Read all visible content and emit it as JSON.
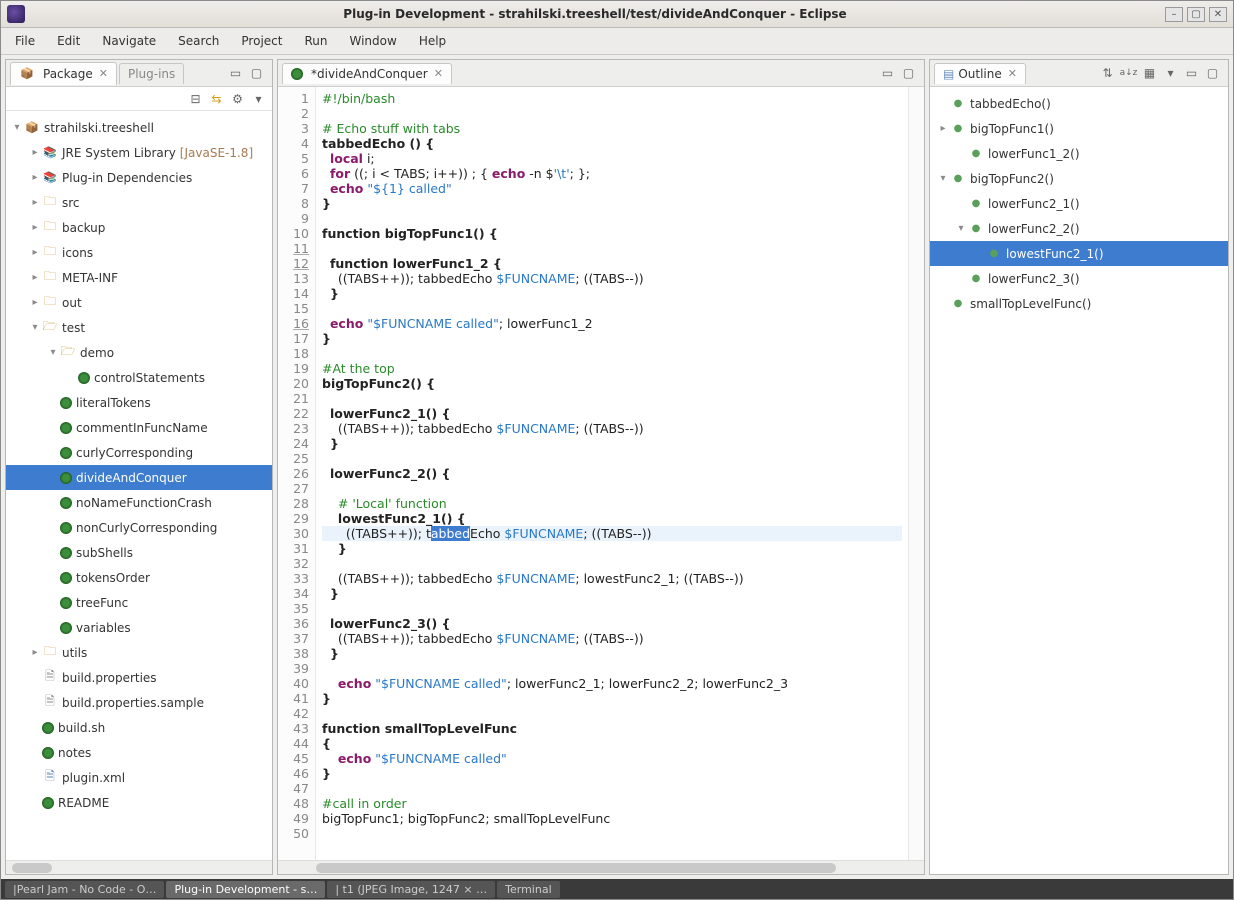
{
  "title": "Plug-in Development - strahilski.treeshell/test/divideAndConquer - Eclipse",
  "menus": [
    "File",
    "Edit",
    "Navigate",
    "Search",
    "Project",
    "Run",
    "Window",
    "Help"
  ],
  "leftView": {
    "tabs": [
      {
        "label": "Package",
        "active": true,
        "closex": "✕"
      },
      {
        "label": "Plug-ins",
        "active": false
      }
    ],
    "project": "strahilski.treeshell",
    "jre_label": "JRE System Library",
    "jre_extra": "[JavaSE-1.8]",
    "plugin_deps": "Plug-in Dependencies",
    "folders": {
      "src": "src",
      "backup": "backup",
      "icons": "icons",
      "metainf": "META-INF",
      "out": "out",
      "test": "test",
      "demo": "demo",
      "utils": "utils"
    },
    "demo_child": "controlStatements",
    "test_files": [
      "literalTokens",
      "commentInFuncName",
      "curlyCorresponding",
      "divideAndConquer",
      "noNameFunctionCrash",
      "nonCurlyCorresponding",
      "subShells",
      "tokensOrder",
      "treeFunc",
      "variables"
    ],
    "root_files": {
      "build_properties": "build.properties",
      "build_properties_sample": "build.properties.sample",
      "build_sh": "build.sh",
      "notes": "notes",
      "plugin_xml": "plugin.xml",
      "readme": "README"
    },
    "selected": "divideAndConquer"
  },
  "editor": {
    "tab_label": "*divideAndConquer",
    "lines": [
      {
        "n": 1,
        "html": "<span class='cm'>#!/bin/bash</span>"
      },
      {
        "n": 2,
        "html": ""
      },
      {
        "n": 3,
        "html": "<span class='cm'># Echo stuff with tabs</span>"
      },
      {
        "n": 4,
        "html": "<span class='funcdef'>tabbedEcho () {</span>"
      },
      {
        "n": 5,
        "html": "  <span class='kw'>local</span> i;"
      },
      {
        "n": 6,
        "html": "  <span class='kw'>for</span> ((; i &lt; TABS; i++)) ; { <span class='kw'>echo</span> -n $<span class='str'>'\\t'</span>; };"
      },
      {
        "n": 7,
        "html": "  <span class='kw'>echo</span> <span class='str'>\"<span class='var'>${1}</span> called\"</span>"
      },
      {
        "n": 8,
        "html": "<span class='funcdef'>}</span>"
      },
      {
        "n": 9,
        "html": ""
      },
      {
        "n": 10,
        "html": "<span class='funcdef'>function bigTopFunc1() {</span>"
      },
      {
        "n": 11,
        "html": "",
        "u": true
      },
      {
        "n": 12,
        "html": "  <span class='funcdef'>function lowerFunc1_2 {</span>",
        "u": true
      },
      {
        "n": 13,
        "html": "    ((TABS++)); tabbedEcho <span class='var'>$FUNCNAME</span>; ((TABS--))"
      },
      {
        "n": 14,
        "html": "  <span class='funcdef'>}</span>"
      },
      {
        "n": 15,
        "html": ""
      },
      {
        "n": 16,
        "html": "  <span class='kw'>echo</span> <span class='str'>\"<span class='var'>$FUNCNAME</span> called\"</span>; lowerFunc1_2",
        "u": true
      },
      {
        "n": 17,
        "html": "<span class='funcdef'>}</span>"
      },
      {
        "n": 18,
        "html": ""
      },
      {
        "n": 19,
        "html": "<span class='cm'>#At the top</span>"
      },
      {
        "n": 20,
        "html": "<span class='funcdef'>bigTopFunc2() {</span>"
      },
      {
        "n": 21,
        "html": ""
      },
      {
        "n": 22,
        "html": "  <span class='funcdef'>lowerFunc2_1() {</span>"
      },
      {
        "n": 23,
        "html": "    ((TABS++)); tabbedEcho <span class='var'>$FUNCNAME</span>; ((TABS--))"
      },
      {
        "n": 24,
        "html": "  <span class='funcdef'>}</span>"
      },
      {
        "n": 25,
        "html": ""
      },
      {
        "n": 26,
        "html": "  <span class='funcdef'>lowerFunc2_2() {</span>"
      },
      {
        "n": 27,
        "html": ""
      },
      {
        "n": 28,
        "html": "    <span class='cm'># 'Local' function</span>"
      },
      {
        "n": 29,
        "html": "    <span class='funcdef'>lowestFunc2_1() {</span>"
      },
      {
        "n": 30,
        "html": "      ((TABS++)); t<span class='sel'>abbed</span>Echo <span class='var'>$FUNCNAME</span>; ((TABS--))",
        "hl": true
      },
      {
        "n": 31,
        "html": "    <span class='funcdef'>}</span>"
      },
      {
        "n": 32,
        "html": ""
      },
      {
        "n": 33,
        "html": "    ((TABS++)); tabbedEcho <span class='var'>$FUNCNAME</span>; lowestFunc2_1; ((TABS--))"
      },
      {
        "n": 34,
        "html": "  <span class='funcdef'>}</span>"
      },
      {
        "n": 35,
        "html": ""
      },
      {
        "n": 36,
        "html": "  <span class='funcdef'>lowerFunc2_3() {</span>"
      },
      {
        "n": 37,
        "html": "    ((TABS++)); tabbedEcho <span class='var'>$FUNCNAME</span>; ((TABS--))"
      },
      {
        "n": 38,
        "html": "  <span class='funcdef'>}</span>"
      },
      {
        "n": 39,
        "html": ""
      },
      {
        "n": 40,
        "html": "    <span class='kw'>echo</span> <span class='str'>\"<span class='var'>$FUNCNAME</span> called\"</span>; lowerFunc2_1; lowerFunc2_2; lowerFunc2_3"
      },
      {
        "n": 41,
        "html": "<span class='funcdef'>}</span>"
      },
      {
        "n": 42,
        "html": ""
      },
      {
        "n": 43,
        "html": "<span class='funcdef'>function smallTopLevelFunc</span>"
      },
      {
        "n": 44,
        "html": "<span class='funcdef'>{</span>"
      },
      {
        "n": 45,
        "html": "    <span class='kw'>echo</span> <span class='str'>\"<span class='var'>$FUNCNAME</span> called\"</span>"
      },
      {
        "n": 46,
        "html": "<span class='funcdef'>}</span>"
      },
      {
        "n": 47,
        "html": ""
      },
      {
        "n": 48,
        "html": "<span class='cm'>#call in order</span>"
      },
      {
        "n": 49,
        "html": "bigTopFunc1; bigTopFunc2; smallTopLevelFunc"
      },
      {
        "n": 50,
        "html": ""
      }
    ]
  },
  "outline": {
    "title": "Outline",
    "items": [
      {
        "label": "tabbedEcho()",
        "depth": 0
      },
      {
        "label": "bigTopFunc1()",
        "depth": 0,
        "exp": "closed"
      },
      {
        "label": "lowerFunc1_2()",
        "depth": 1
      },
      {
        "label": "bigTopFunc2()",
        "depth": 0,
        "exp": "open"
      },
      {
        "label": "lowerFunc2_1()",
        "depth": 1
      },
      {
        "label": "lowerFunc2_2()",
        "depth": 1,
        "exp": "open"
      },
      {
        "label": "lowestFunc2_1()",
        "depth": 2,
        "selected": true
      },
      {
        "label": "lowerFunc2_3()",
        "depth": 1
      },
      {
        "label": "smallTopLevelFunc()",
        "depth": 0
      }
    ]
  },
  "taskbar": [
    {
      "label": "|Pearl Jam - No Code - O…"
    },
    {
      "label": "Plug-in Development - s…",
      "active": true
    },
    {
      "label": "| t1 (JPEG Image, 1247 × …"
    },
    {
      "label": "Terminal"
    }
  ]
}
